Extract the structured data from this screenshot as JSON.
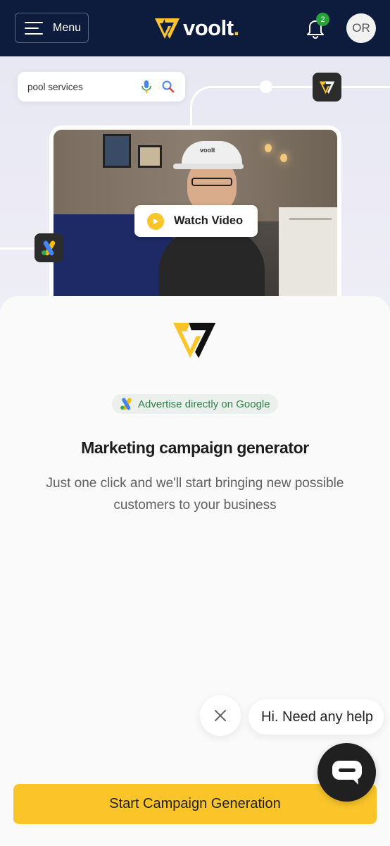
{
  "header": {
    "menu_label": "Menu",
    "logo_text": "voolt",
    "logo_dot": ".",
    "notification_count": "2",
    "avatar_initials": "OR"
  },
  "hero": {
    "search_query": "pool services",
    "video_cap_text": "voolt",
    "watch_video_label": "Watch Video"
  },
  "content": {
    "google_chip_label": "Advertise directly on Google",
    "title": "Marketing campaign generator",
    "subtitle": "Just one click and we'll start bringing new possible customers to your business"
  },
  "chat": {
    "help_text": "Hi. Need any help"
  },
  "cta": {
    "label": "Start Campaign Generation"
  },
  "colors": {
    "navy": "#0d1b3d",
    "brand_yellow": "#fbc52a",
    "badge_green": "#23a537",
    "chip_green": "#2e8049"
  },
  "icons": [
    "menu-icon",
    "voolt-logo-icon",
    "bell-icon",
    "mic-icon",
    "search-icon",
    "google-ads-icon",
    "play-icon",
    "close-icon",
    "chat-icon"
  ]
}
